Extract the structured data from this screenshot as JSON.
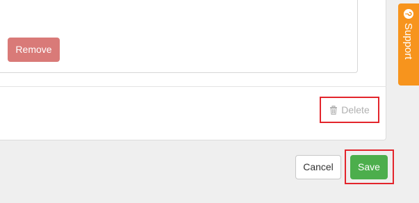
{
  "form": {
    "remove_label": "Remove",
    "delete_label": "Delete"
  },
  "footer": {
    "cancel_label": "Cancel",
    "save_label": "Save"
  },
  "support": {
    "label": "Support"
  },
  "icons": {
    "delete": "trash-icon",
    "support": "help-circle-icon"
  },
  "colors": {
    "remove_button": "#d97a78",
    "save_button": "#4cae4c",
    "support_tab": "#f7941d",
    "highlight": "#e3242b",
    "delete_text": "#b0b0b0"
  }
}
